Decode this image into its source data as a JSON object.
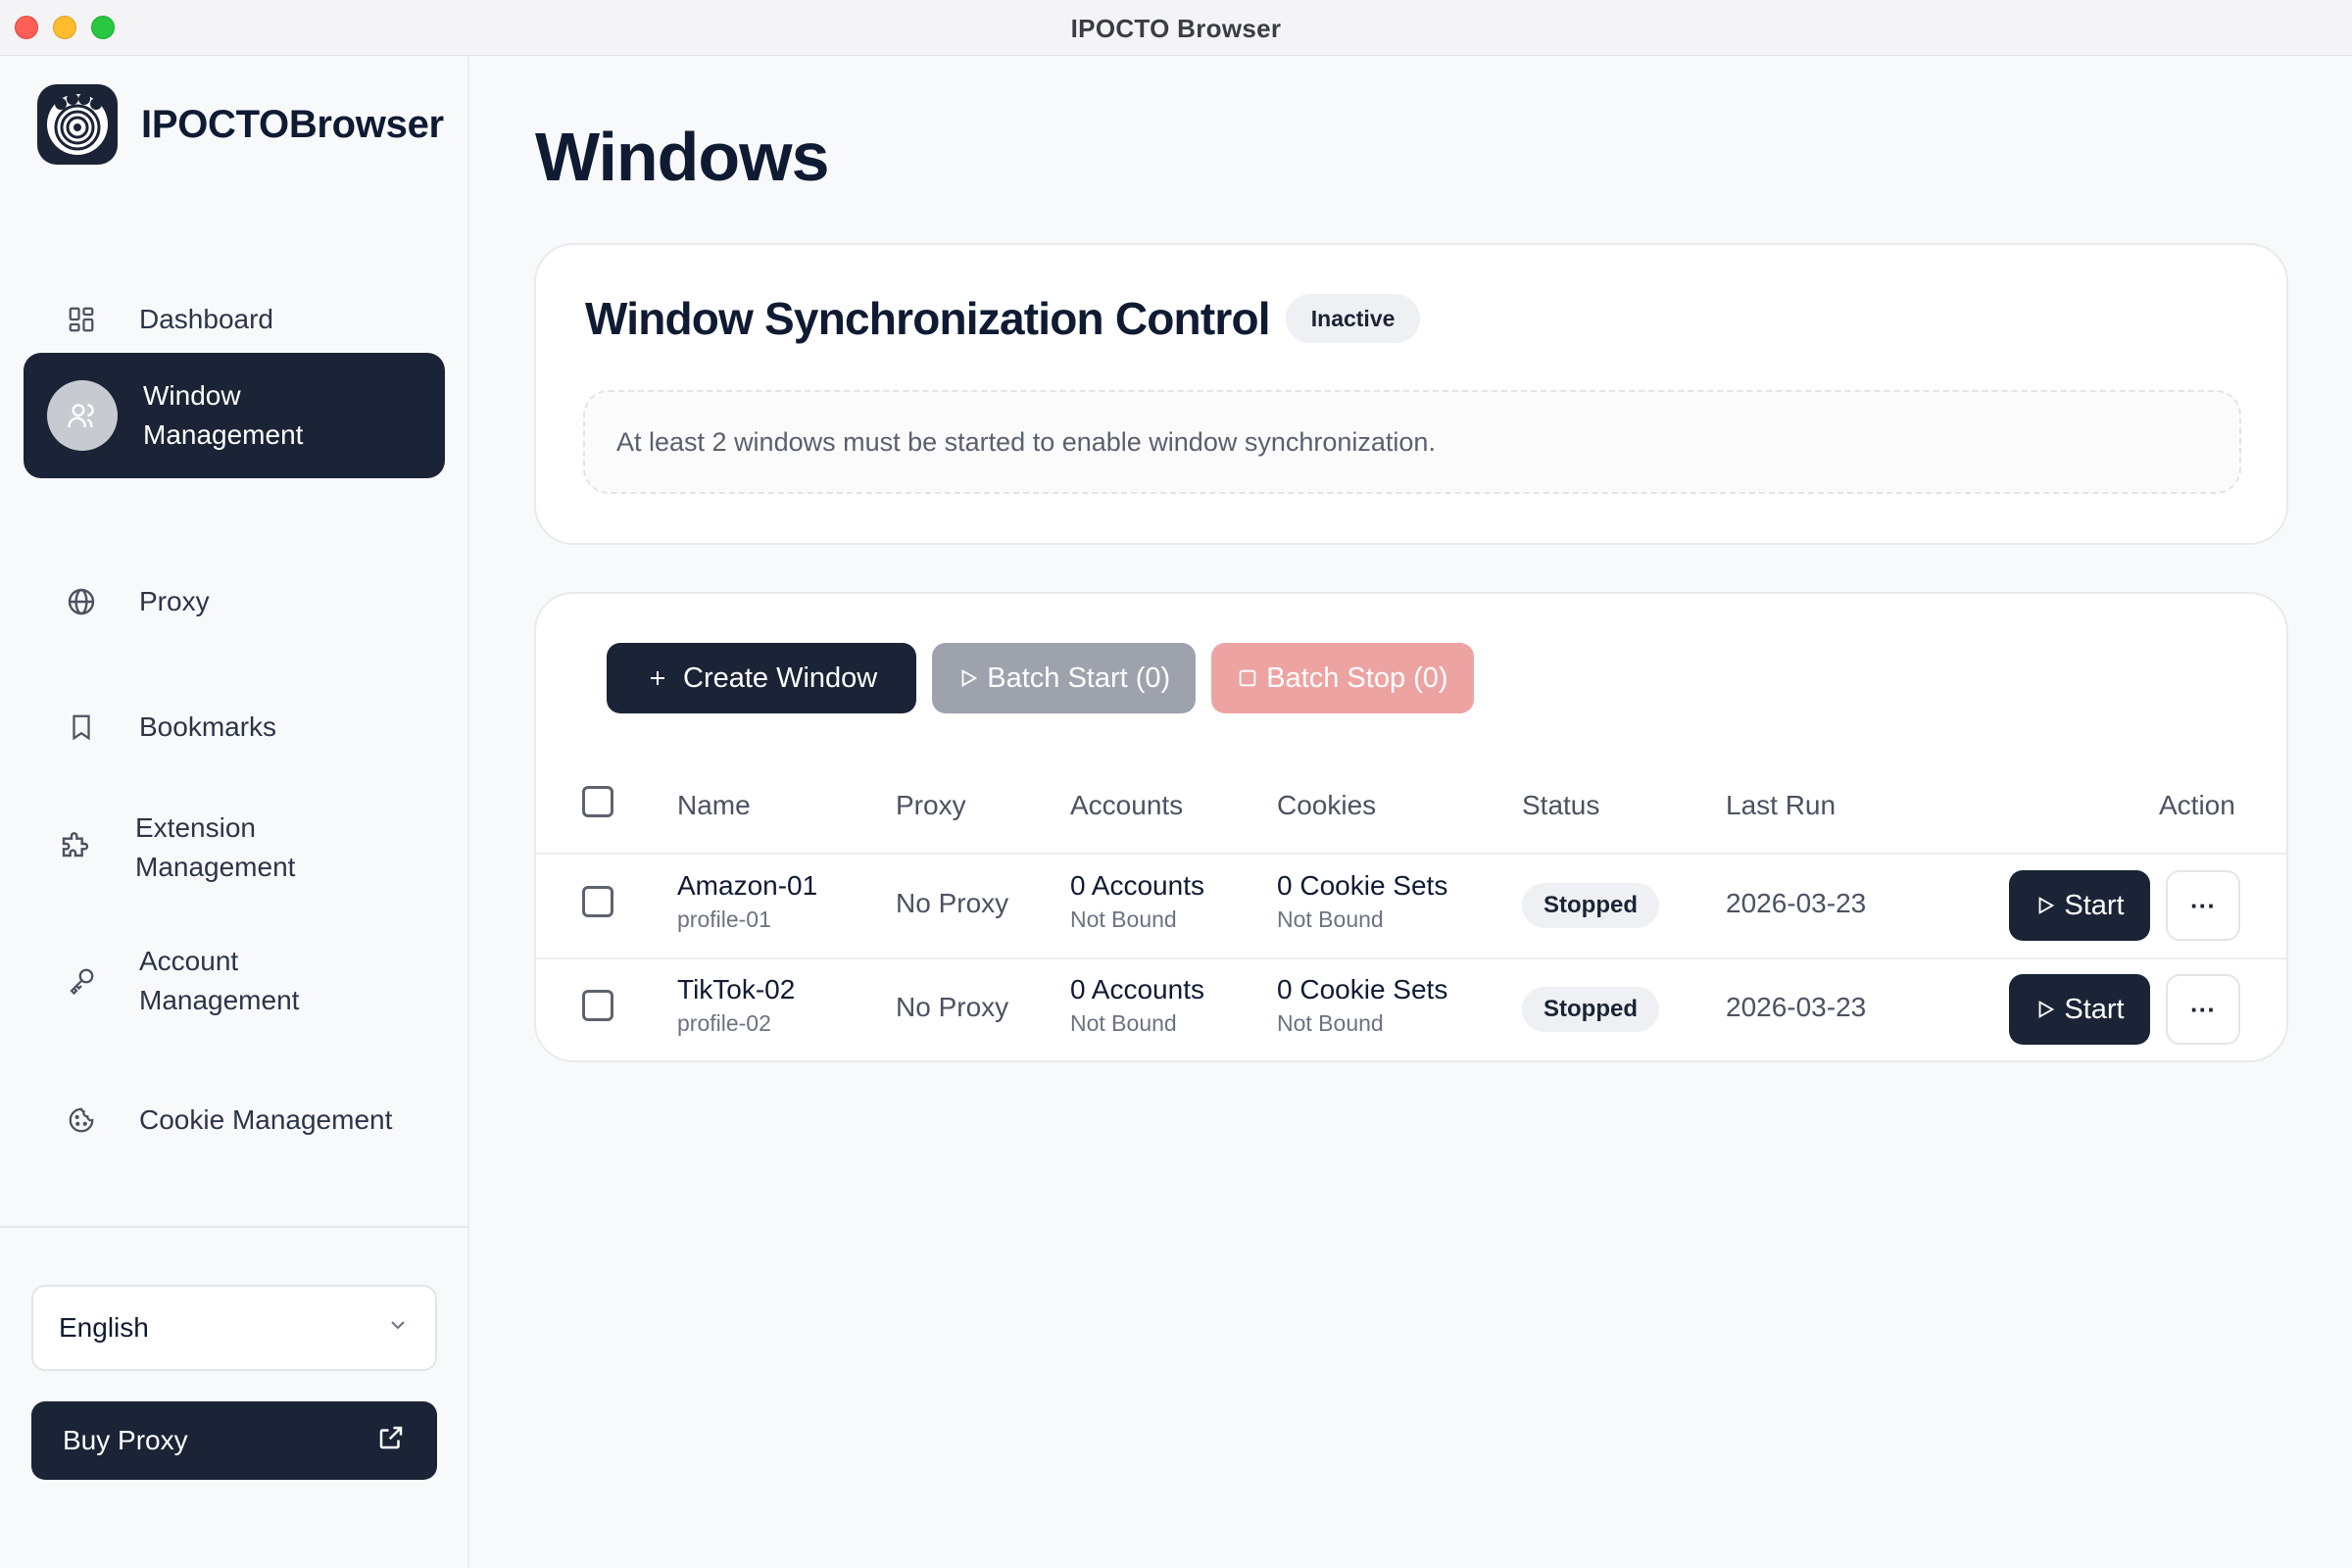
{
  "window": {
    "title": "IPOCTO Browser"
  },
  "sidebar": {
    "brand_name": "IPOCTOBrowser",
    "items": [
      {
        "label": "Dashboard",
        "icon": "dashboard-grid-icon"
      },
      {
        "label": "Window\nManagement",
        "icon": "users-icon",
        "active": true
      },
      {
        "label": "Proxy",
        "icon": "globe-icon"
      },
      {
        "label": "Bookmarks",
        "icon": "bookmark-icon"
      },
      {
        "label": "Extension\nManagement",
        "icon": "puzzle-icon"
      },
      {
        "label": "Account\nManagement",
        "icon": "key-icon"
      },
      {
        "label": "Cookie Management",
        "icon": "cookie-icon"
      }
    ],
    "language": {
      "selected": "English"
    },
    "buy_proxy": {
      "label": "Buy Proxy",
      "icon": "external-link-icon"
    }
  },
  "main": {
    "title": "Windows",
    "sync": {
      "title": "Window Synchronization Control",
      "badge": "Inactive",
      "note": "At least 2 windows must be started to enable window synchronization."
    },
    "toolbar": {
      "create": "Create Window",
      "batch_start": "Batch Start (0)",
      "batch_stop": "Batch Stop (0)"
    },
    "table": {
      "headers": {
        "name": "Name",
        "proxy": "Proxy",
        "accounts": "Accounts",
        "cookies": "Cookies",
        "status": "Status",
        "last_run": "Last Run",
        "action": "Action"
      },
      "rows": [
        {
          "name": "Amazon-01",
          "profile": "profile-01",
          "proxy": "No Proxy",
          "accounts": "0 Accounts",
          "accounts_sub": "Not Bound",
          "cookies": "0 Cookie Sets",
          "cookies_sub": "Not Bound",
          "status": "Stopped",
          "last_run": "2026-03-23",
          "start": "Start",
          "more": "···"
        },
        {
          "name": "TikTok-02",
          "profile": "profile-02",
          "proxy": "No Proxy",
          "accounts": "0 Accounts",
          "accounts_sub": "Not Bound",
          "cookies": "0 Cookie Sets",
          "cookies_sub": "Not Bound",
          "status": "Stopped",
          "last_run": "2026-03-23",
          "start": "Start",
          "more": "···"
        }
      ]
    }
  },
  "colors": {
    "primary": "#1b2436",
    "batch_start": "#9da2ac",
    "batch_stop": "#eea3a3",
    "traffic_red": "#fe5f57",
    "traffic_yellow": "#febc2e",
    "traffic_green": "#28c840"
  }
}
